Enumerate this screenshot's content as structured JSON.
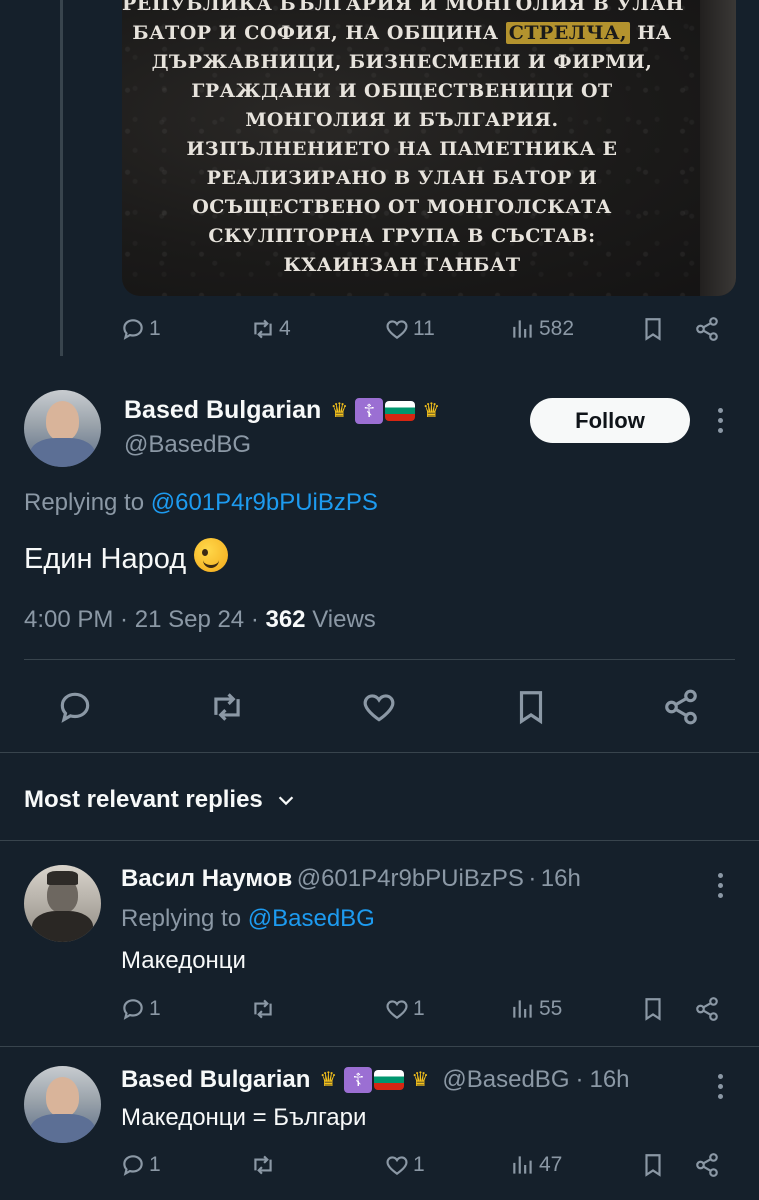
{
  "top_post": {
    "image_lines": [
      "РЕПУБЛИКА БЪЛГАРИЯ И МОНГОЛИЯ В УЛАН",
      "БАТОР И СОФИЯ, НА ОБЩИНА",
      "ДЪРЖАВНИЦИ,  БИЗНЕСМЕНИ И ФИРМИ,",
      "ГРАЖДАНИ И ОБЩЕСТВЕНИЦИ ОТ",
      "МОНГОЛИЯ И БЪЛГАРИЯ.",
      "ИЗПЪЛНЕНИЕТО НА ПАМЕТНИКА Е",
      "РЕАЛИЗИРАНО В УЛАН БАТОР И",
      "ОСЪЩЕСТВЕНО ОТ МОНГОЛСКАТА",
      "СКУЛПТОРНА ГРУПА В СЪСТАВ:",
      "КХАИНЗАН ГАНБАТ"
    ],
    "image_highlight": "СТРЕЛЧА,",
    "image_line2_tail": "НА",
    "stats": {
      "replies": "1",
      "reposts": "4",
      "likes": "11",
      "views": "582"
    }
  },
  "main_tweet": {
    "name": "Based Bulgarian",
    "handle": "@BasedBG",
    "follow_label": "Follow",
    "replying_prefix": "Replying to",
    "replying_to": "@601P4r9bPUiBzPS",
    "text": "Един Народ",
    "time": "4:00 PM",
    "date": "21 Sep 24",
    "views_count": "362",
    "views_label": "Views"
  },
  "replies_section": {
    "title": "Most relevant replies"
  },
  "replies": [
    {
      "name": "Васил Наумов",
      "handle": "@601P4r9bPUiBzPS",
      "age": "16h",
      "replying_prefix": "Replying to",
      "replying_to": "@BasedBG",
      "text": "Македонци",
      "stats": {
        "replies": "1",
        "reposts": "",
        "likes": "1",
        "views": "55"
      }
    },
    {
      "name": "Based Bulgarian",
      "handle": "@BasedBG",
      "age": "16h",
      "text": "Македонци = Българи",
      "stats": {
        "replies": "1",
        "reposts": "",
        "likes": "1",
        "views": "47"
      }
    }
  ],
  "icons": {
    "reply": "reply-icon",
    "repost": "repost-icon",
    "like": "heart-icon",
    "views": "views-icon",
    "bookmark": "bookmark-icon",
    "share": "share-icon",
    "more": "more-icon",
    "chevron": "chevron-down-icon"
  },
  "colors": {
    "background": "#15202b",
    "link": "#1d9bf0",
    "muted": "#8b98a5",
    "highlight": "#b4932e"
  }
}
